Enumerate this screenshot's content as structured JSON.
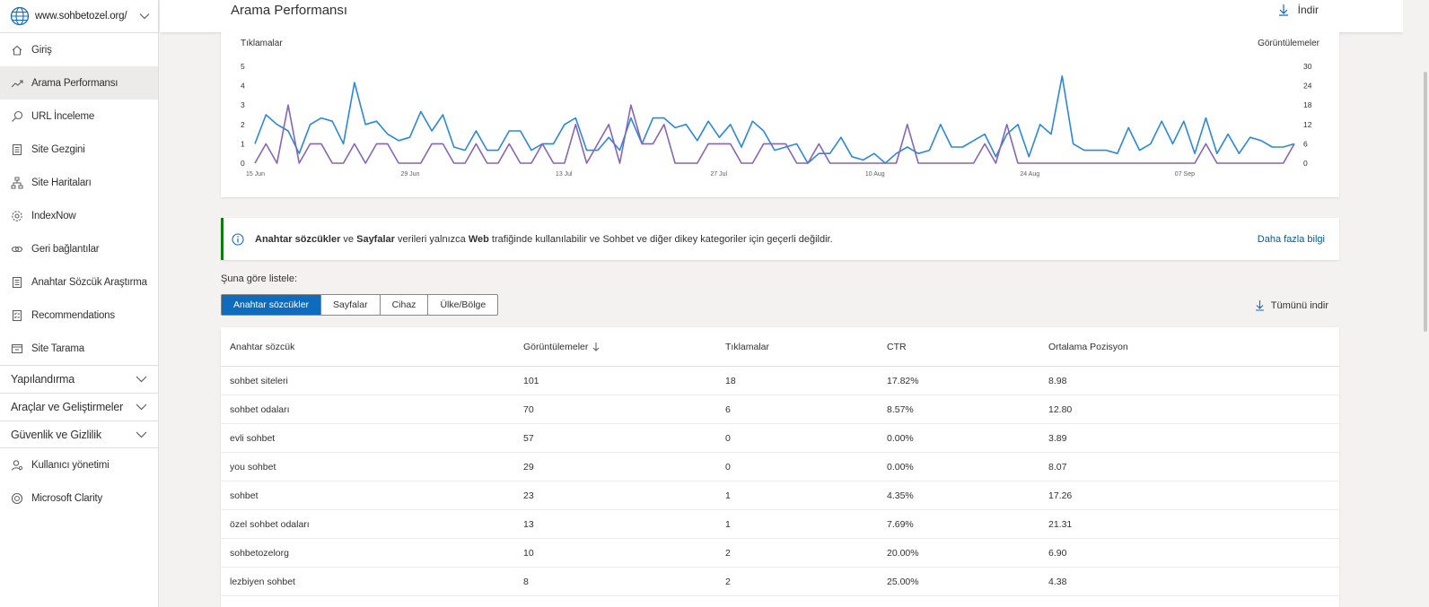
{
  "site": {
    "url": "www.sohbetozel.org/"
  },
  "sidebar": {
    "items": [
      {
        "label": "Giriş",
        "icon": "home-icon"
      },
      {
        "label": "Arama Performansı",
        "icon": "trend-icon",
        "active": true
      },
      {
        "label": "URL İnceleme",
        "icon": "search-icon"
      },
      {
        "label": "Site Gezgini",
        "icon": "document-icon"
      },
      {
        "label": "Site Haritaları",
        "icon": "sitemap-icon"
      },
      {
        "label": "IndexNow",
        "icon": "gear-icon"
      },
      {
        "label": "Geri bağlantılar",
        "icon": "link-icon"
      },
      {
        "label": "Anahtar Sözcük Araştırma",
        "icon": "document-icon"
      },
      {
        "label": "Recommendations",
        "icon": "checklist-icon"
      },
      {
        "label": "Site Tarama",
        "icon": "scan-icon"
      }
    ],
    "groups": [
      {
        "label": "Yapılandırma"
      },
      {
        "label": "Araçlar ve Geliştirmeler"
      },
      {
        "label": "Güvenlik ve Gizlilik"
      }
    ],
    "bottom_items": [
      {
        "label": "Kullanıcı yönetimi",
        "icon": "user-icon"
      },
      {
        "label": "Microsoft Clarity",
        "icon": "clarity-icon"
      }
    ]
  },
  "header": {
    "title": "Arama Performansı",
    "download_label": "İndir"
  },
  "chart_data": {
    "type": "line",
    "left_axis_title": "Tıklamalar",
    "right_axis_title": "Görüntülemeler",
    "left_ylim": [
      0,
      5
    ],
    "right_ylim": [
      0,
      30
    ],
    "left_ticks": [
      "5",
      "4",
      "3",
      "2",
      "1",
      "0"
    ],
    "right_ticks": [
      "30",
      "24",
      "18",
      "12",
      "6",
      "0"
    ],
    "x_tick_labels": [
      "15 Jun",
      "29 Jun",
      "13 Jul",
      "27 Jul",
      "10 Aug",
      "24 Aug",
      "07 Sep"
    ],
    "series": [
      {
        "name": "Görüntülemeler",
        "color": "#2b88d8",
        "axis": "right",
        "values": [
          6,
          15,
          12,
          10,
          3,
          12,
          14,
          13,
          6,
          25,
          12,
          13,
          9,
          7,
          8,
          16,
          10,
          15,
          5,
          4,
          10,
          4,
          4,
          10,
          10,
          4,
          6,
          6,
          12,
          14,
          4,
          4,
          8,
          4,
          14,
          6,
          14,
          14,
          11,
          12,
          7,
          13,
          8,
          12,
          5,
          13,
          10,
          4,
          5,
          6,
          0,
          3,
          3,
          8,
          2,
          1,
          3,
          0,
          3,
          5,
          3,
          4,
          12,
          5,
          5,
          7,
          9,
          2,
          9,
          12,
          2,
          12,
          9,
          27,
          6,
          4,
          4,
          4,
          3,
          11,
          4,
          6,
          13,
          6,
          13,
          3,
          14,
          3,
          9,
          3,
          8,
          7,
          5,
          5,
          6
        ]
      },
      {
        "name": "Tıklamalar",
        "color": "#8764b8",
        "axis": "left",
        "values": [
          0,
          1,
          0,
          3,
          0,
          1,
          1,
          0,
          0,
          1,
          0,
          1,
          1,
          0,
          0,
          0,
          1,
          1,
          0,
          0,
          1,
          0,
          0,
          1,
          0,
          0,
          1,
          0,
          0,
          2,
          0,
          1,
          2,
          0,
          3,
          1,
          1,
          2,
          0,
          0,
          0,
          1,
          1,
          1,
          0,
          0,
          1,
          1,
          1,
          0,
          0,
          1,
          0,
          0,
          0,
          0,
          0,
          0,
          0,
          2,
          0,
          0,
          0,
          0,
          0,
          0,
          1,
          0,
          2,
          0,
          0,
          0,
          0,
          0,
          0,
          0,
          0,
          0,
          0,
          0,
          0,
          0,
          0,
          0,
          0,
          0,
          1,
          0,
          0,
          0,
          0,
          0,
          0,
          0,
          1
        ]
      }
    ]
  },
  "info": {
    "bold1": "Anahtar sözcükler",
    "mid1": " ve ",
    "bold2": "Sayfalar",
    "mid2": " verileri yalnızca ",
    "bold3": "Web",
    "tail": " trafiğinde kullanılabilir ve Sohbet ve diğer dikey kategoriler için geçerli değildir.",
    "link": "Daha fazla bilgi"
  },
  "list": {
    "label": "Şuna göre listele:",
    "tabs": [
      "Anahtar sözcükler",
      "Sayfalar",
      "Cihaz",
      "Ülke/Bölge"
    ],
    "download_all": "Tümünü indir"
  },
  "table": {
    "columns": [
      "Anahtar sözcük",
      "Görüntülemeler",
      "Tıklamalar",
      "CTR",
      "Ortalama Pozisyon"
    ],
    "rows": [
      [
        "sohbet siteleri",
        "101",
        "18",
        "17.82%",
        "8.98"
      ],
      [
        "sohbet odaları",
        "70",
        "6",
        "8.57%",
        "12.80"
      ],
      [
        "evli sohbet",
        "57",
        "0",
        "0.00%",
        "3.89"
      ],
      [
        "you sohbet",
        "29",
        "0",
        "0.00%",
        "8.07"
      ],
      [
        "sohbet",
        "23",
        "1",
        "4.35%",
        "17.26"
      ],
      [
        "özel sohbet odaları",
        "13",
        "1",
        "7.69%",
        "21.31"
      ],
      [
        "sohbetozelorg",
        "10",
        "2",
        "20.00%",
        "6.90"
      ],
      [
        "lezbiyen sohbet",
        "8",
        "2",
        "25.00%",
        "4.38"
      ]
    ]
  }
}
